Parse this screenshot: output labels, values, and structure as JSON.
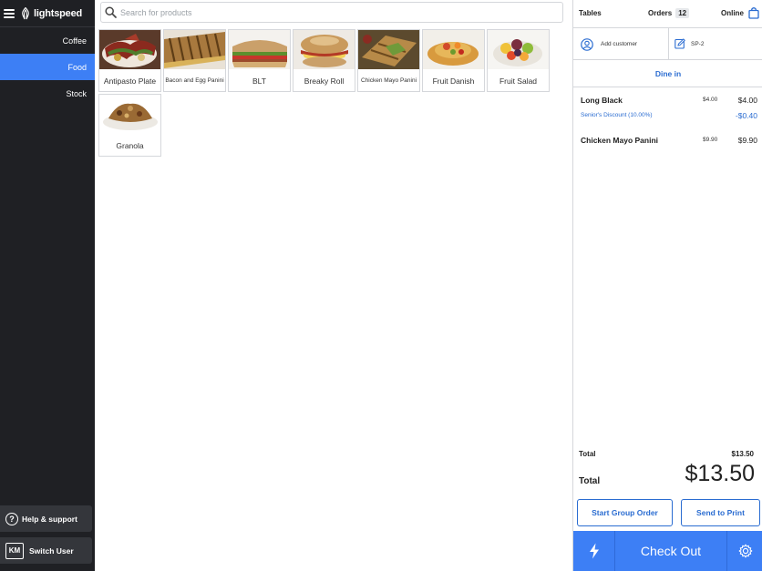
{
  "brand": {
    "name": "lightspeed"
  },
  "sidebar": {
    "categories": [
      {
        "label": "Coffee",
        "active": false
      },
      {
        "label": "Food",
        "active": true
      },
      {
        "label": "Stock",
        "active": false
      }
    ],
    "help_label": "Help & support",
    "switch_user_label": "Switch User",
    "user_initials": "KM"
  },
  "search": {
    "placeholder": "Search for products",
    "value": ""
  },
  "products": [
    {
      "name": "Antipasto Plate",
      "icon": "antipasto-plate-photo"
    },
    {
      "name": "Bacon and Egg Panini",
      "icon": "bacon-egg-panini-photo"
    },
    {
      "name": "BLT",
      "icon": "blt-photo"
    },
    {
      "name": "Breaky Roll",
      "icon": "breaky-roll-photo"
    },
    {
      "name": "Chicken Mayo Panini",
      "icon": "chicken-mayo-panini-photo"
    },
    {
      "name": "Fruit Danish",
      "icon": "fruit-danish-photo"
    },
    {
      "name": "Fruit Salad",
      "icon": "fruit-salad-photo"
    },
    {
      "name": "Granola",
      "icon": "granola-photo"
    }
  ],
  "topbar": {
    "tables_label": "Tables",
    "orders_label": "Orders",
    "orders_count": "12",
    "online_label": "Online"
  },
  "order": {
    "add_customer_label": "Add customer",
    "reference": "SP-2",
    "order_type": "Dine in",
    "lines": [
      {
        "name": "Long Black",
        "unit": "$4.00",
        "total": "$4.00"
      },
      {
        "name": "Chicken Mayo Panini",
        "unit": "$9.90",
        "total": "$9.90"
      }
    ],
    "discount": {
      "label": "Senior's Discount (10.00%)",
      "amount": "-$0.40"
    },
    "subtotal_label": "Total",
    "subtotal_value": "$13.50",
    "total_label": "Total",
    "total_value": "$13.50",
    "group_order_label": "Start Group Order",
    "send_print_label": "Send to Print",
    "checkout_label": "Check Out"
  },
  "colors": {
    "accent": "#3d7ff5",
    "link": "#2a6cd1",
    "sidebar": "#1f2024"
  }
}
